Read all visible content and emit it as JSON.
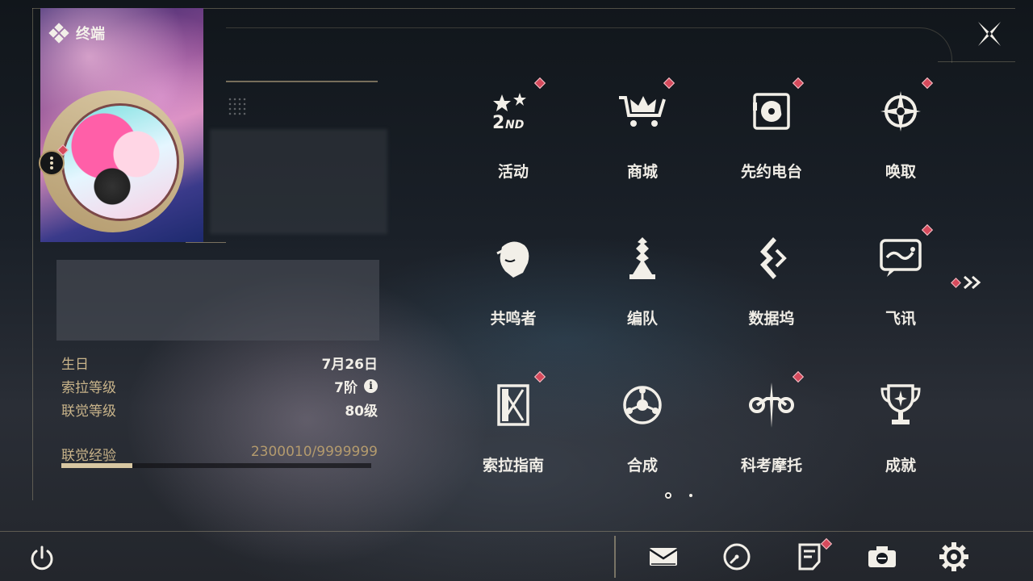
{
  "header": {
    "title": "终端"
  },
  "profile": {
    "stats": [
      {
        "label": "生日",
        "value": "7月26日"
      },
      {
        "label": "索拉等级",
        "value": "7阶",
        "info": true
      },
      {
        "label": "联觉等级",
        "value": "80级"
      }
    ],
    "exp": {
      "label": "联觉经验",
      "value": "2300010/9999999",
      "fraction": 0.23
    }
  },
  "menu": [
    {
      "label": "活动",
      "icon": "anniversary-2nd-icon",
      "badge": true
    },
    {
      "label": "商城",
      "icon": "shop-crown-cart-icon",
      "badge": true
    },
    {
      "label": "先约电台",
      "icon": "radio-turntable-icon",
      "badge": true
    },
    {
      "label": "唤取",
      "icon": "convene-star-icon",
      "badge": true
    },
    {
      "label": "共鸣者",
      "icon": "resonator-portrait-icon",
      "badge": false
    },
    {
      "label": "编队",
      "icon": "team-chess-icon",
      "badge": false
    },
    {
      "label": "数据坞",
      "icon": "data-bank-icon",
      "badge": false
    },
    {
      "label": "飞讯",
      "icon": "message-chat-icon",
      "badge": true
    },
    {
      "label": "索拉指南",
      "icon": "guidebook-icon",
      "badge": true
    },
    {
      "label": "合成",
      "icon": "synthesis-icon",
      "badge": false
    },
    {
      "label": "科考摩托",
      "icon": "motorcycle-icon",
      "badge": true
    },
    {
      "label": "成就",
      "icon": "trophy-icon",
      "badge": false
    }
  ],
  "pager": {
    "current": 1,
    "total": 2
  },
  "bottom_bar": {
    "tools": [
      "mail-icon",
      "clock-icon",
      "notice-icon",
      "camera-icon",
      "settings-gear-icon"
    ],
    "notice_badge": true
  },
  "colors": {
    "accent_gold": "#c9b48a",
    "badge_red": "#d64a5c",
    "text_light": "#f0ede6"
  }
}
